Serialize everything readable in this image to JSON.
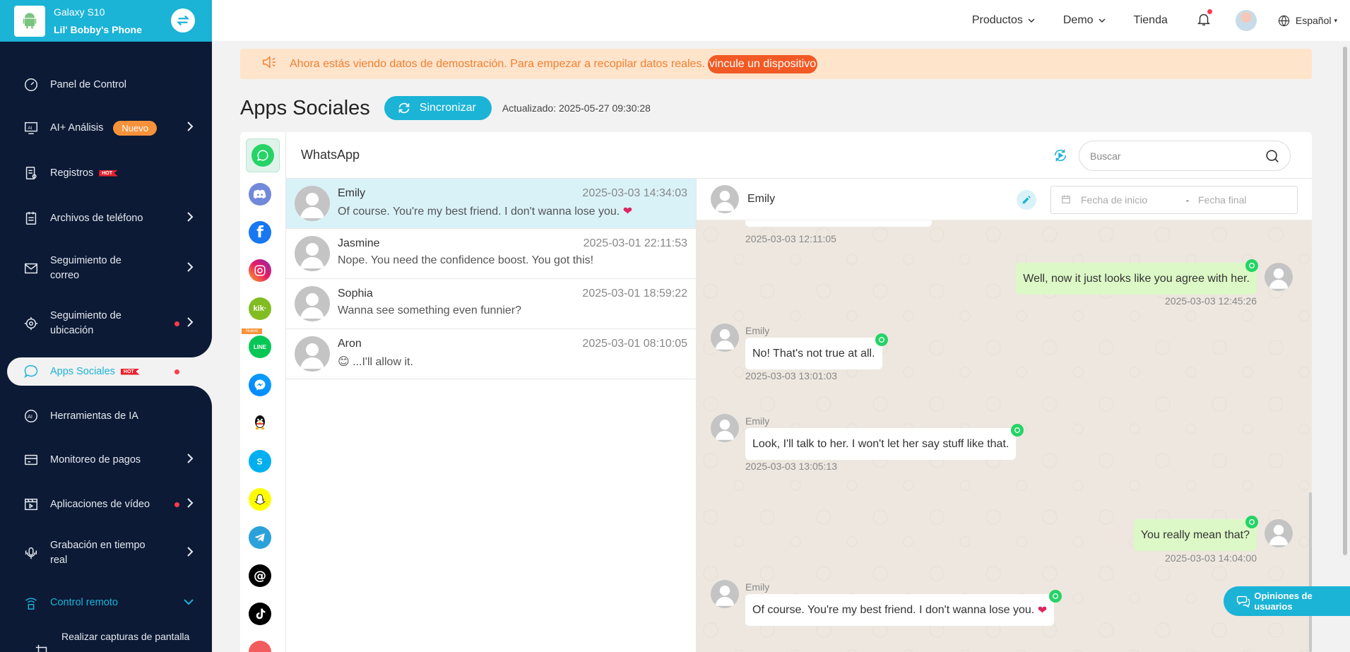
{
  "device": {
    "model": "Galaxy S10",
    "name": "Lil' Bobby's Phone"
  },
  "sidebar": {
    "items": [
      {
        "label": "Panel de Control",
        "icon": "dashboard-icon"
      },
      {
        "label": "AI+ Análisis",
        "badge": "Nuevo",
        "icon": "ai-analysis-icon"
      },
      {
        "label": "Registros",
        "hot": "HOT",
        "icon": "records-icon"
      },
      {
        "label": "Archivos de teléfono",
        "icon": "phone-files-icon"
      },
      {
        "label": "Seguimiento de correo",
        "icon": "mail-icon"
      },
      {
        "label": "Seguimiento de ubicación",
        "icon": "location-icon"
      },
      {
        "label": "Apps Sociales",
        "hot": "HOT",
        "icon": "chat-icon"
      },
      {
        "label": "Herramientas de IA",
        "icon": "ai-tools-icon"
      },
      {
        "label": "Monitoreo de pagos",
        "icon": "payment-icon"
      },
      {
        "label": "Aplicaciones de vídeo",
        "icon": "video-icon"
      },
      {
        "label": "Grabación en tiempo real",
        "icon": "microphone-icon"
      },
      {
        "label": "Control remoto",
        "icon": "remote-icon"
      },
      {
        "label": "Realizar capturas de pantalla",
        "icon": "screenshot-icon"
      }
    ]
  },
  "topnav": {
    "products": "Productos",
    "demo": "Demo",
    "store": "Tienda",
    "language": "Español"
  },
  "banner": {
    "text": "Ahora estás viendo datos de demostración. Para empezar a recopilar datos reales.",
    "link": "vincule un dispositivo"
  },
  "page": {
    "title": "Apps Sociales",
    "sync": "Sincronizar",
    "updated": "Actualizado: 2025-05-27 09:30:28"
  },
  "apps": {
    "selected": "WhatsApp",
    "new_tag": "Nuevo",
    "list": [
      "whatsapp-icon",
      "discord-icon",
      "facebook-icon",
      "instagram-icon",
      "kik-icon",
      "line-icon",
      "messenger-icon",
      "qq-icon",
      "skype-icon",
      "snapchat-icon",
      "telegram-icon",
      "threads-icon",
      "tiktok-icon"
    ],
    "kik_label": "kik·",
    "line_label": "LINE"
  },
  "search": {
    "placeholder": "Buscar"
  },
  "conversations": [
    {
      "name": "Emily",
      "time": "2025-03-03 14:34:03",
      "message": "Of course. You're my best friend. I don't wanna lose you.",
      "emoji": "❤"
    },
    {
      "name": "Jasmine",
      "time": "2025-03-01 22:11:53",
      "message": "Nope. You need the confidence boost. You got this!"
    },
    {
      "name": "Sophia",
      "time": "2025-03-01 18:59:22",
      "message": "Wanna see something even funnier?"
    },
    {
      "name": "Aron",
      "time": "2025-03-01 08:10:05",
      "message": "...I'll allow it.",
      "emoji": "😊"
    }
  ],
  "chat": {
    "contact": "Emily",
    "start_placeholder": "Fecha de inicio",
    "end_placeholder": "Fecha final",
    "separator": "-",
    "top_timestamp": "2025-03-03 12:11:05",
    "messages": [
      {
        "dir": "out",
        "text": "Well, now it just looks like you agree with her.",
        "time": "2025-03-03 12:45:26"
      },
      {
        "dir": "in",
        "sender": "Emily",
        "text": "No! That's not true at all.",
        "time": "2025-03-03 13:01:03"
      },
      {
        "dir": "in",
        "sender": "Emily",
        "text": "Look, I'll talk to her. I won't let her say stuff like that.",
        "time": "2025-03-03 13:05:13"
      },
      {
        "dir": "out",
        "text": "You really mean that?",
        "time": "2025-03-03 14:04:00"
      },
      {
        "dir": "in",
        "sender": "Emily",
        "text": "Of course. You're my best friend. I don't wanna lose you.",
        "emoji": "❤"
      }
    ]
  },
  "feedback": "Opiniones de usuarios",
  "colors": {
    "accent": "#1bb3d6",
    "sidebar": "#0c1a36",
    "banner_text": "#f08030",
    "hot": "#e8222e",
    "badge": "#f7923a"
  }
}
